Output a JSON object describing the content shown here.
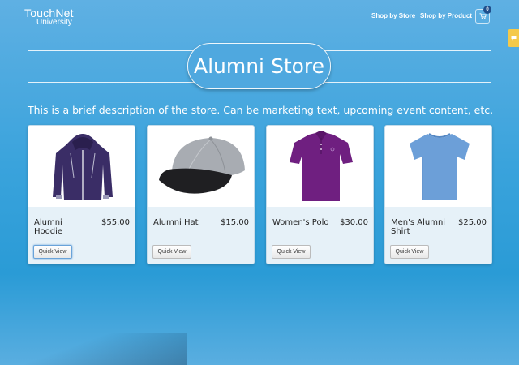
{
  "header": {
    "logo_top": "TouchNet",
    "logo_bottom": "University",
    "nav": [
      {
        "label": "Shop by Store"
      },
      {
        "label": "Shop by Product"
      }
    ],
    "cart_count": "0"
  },
  "title": "Alumni Store",
  "description": "This is a brief description of the store. Can be marketing text, upcoming event content, etc.",
  "products": [
    {
      "name": "Alumni Hoodie",
      "price": "$55.00",
      "button": "Quick View",
      "icon": "hoodie-image"
    },
    {
      "name": "Alumni Hat",
      "price": "$15.00",
      "button": "Quick View",
      "icon": "hat-image"
    },
    {
      "name": "Women's Polo",
      "price": "$30.00",
      "button": "Quick View",
      "icon": "polo-image"
    },
    {
      "name": "Men's Alumni Shirt",
      "price": "$25.00",
      "button": "Quick View",
      "icon": "tshirt-image"
    }
  ],
  "colors": {
    "background": "#3aa3dc",
    "card": "#e6f1f8",
    "badge": "#1f4f8c",
    "side_tab": "#f4c94a"
  }
}
